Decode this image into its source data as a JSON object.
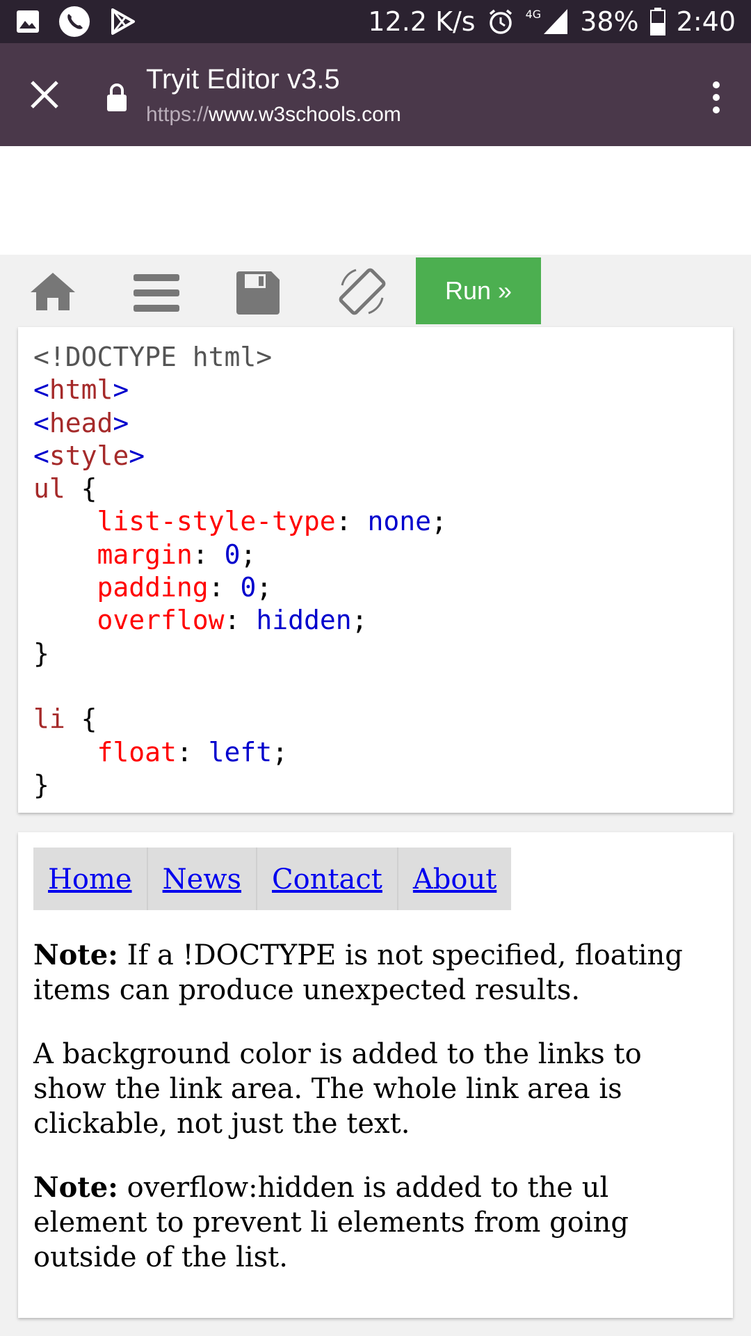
{
  "status_bar": {
    "speed": "12.2 K/s",
    "network": "4G",
    "battery": "38%",
    "time": "2:40"
  },
  "browser": {
    "title": "Tryit Editor v3.5",
    "url_protocol": "https://",
    "url_host": "www.w3schools.com"
  },
  "toolbar": {
    "run_label": "Run »"
  },
  "code": {
    "doctype": "<!DOCTYPE html>",
    "html_open": "<",
    "html_name": "html",
    "html_close": ">",
    "head_name": "head",
    "style_name": "style",
    "ul_selector": "ul",
    "open_brace": " {",
    "close_brace": "}",
    "li_selector": "li",
    "props": [
      {
        "name": "list-style-type",
        "value": "none"
      },
      {
        "name": "margin",
        "value": "0"
      },
      {
        "name": "padding",
        "value": "0"
      },
      {
        "name": "overflow",
        "value": "hidden"
      }
    ],
    "li_props": [
      {
        "name": "float",
        "value": "left"
      }
    ]
  },
  "result": {
    "nav": [
      "Home",
      "News",
      "Contact",
      "About"
    ],
    "note_label": "Note:",
    "note1": " If a !DOCTYPE is not specified, floating items can produce unexpected results.",
    "para2": "A background color is added to the links to show the link area. The whole link area is clickable, not just the text.",
    "note2": " overflow:hidden is added to the ul element to prevent li elements from going outside of the list."
  }
}
